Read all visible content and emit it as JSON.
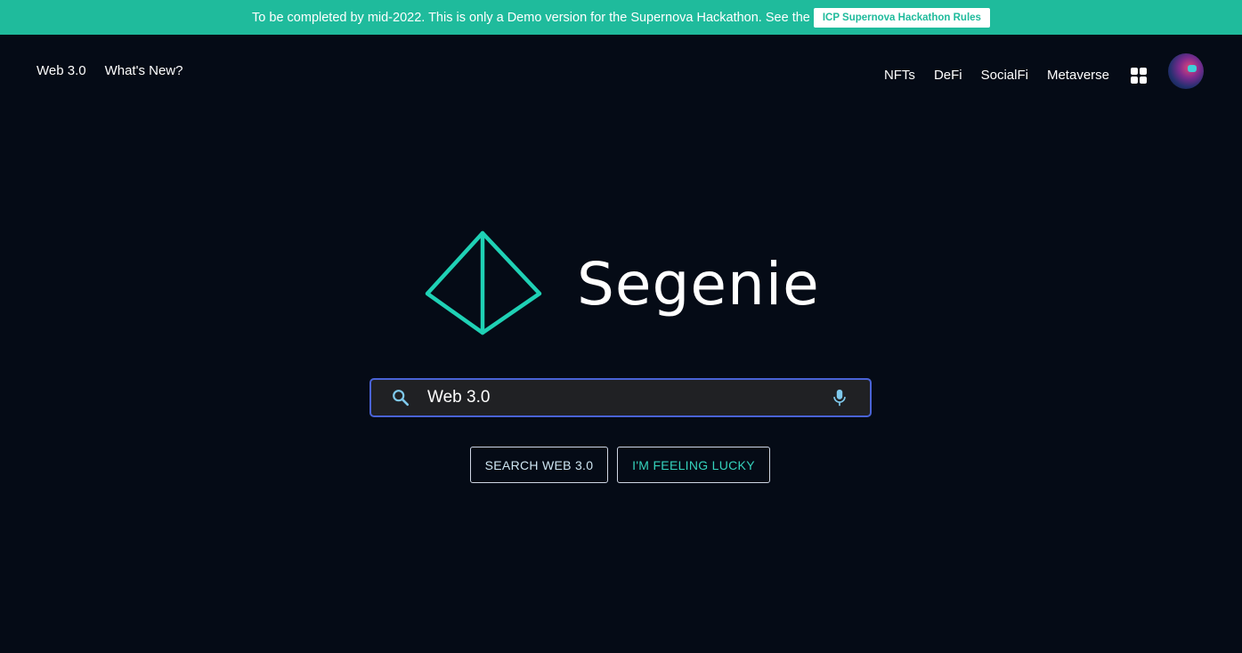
{
  "banner": {
    "text": "To be completed by mid-2022. This is only a Demo version for the Supernova Hackathon. See the",
    "button_label": "ICP Supernova Hackathon Rules"
  },
  "nav_left": [
    {
      "label": "Web 3.0"
    },
    {
      "label": "What's New?"
    }
  ],
  "nav_right": [
    {
      "label": "NFTs"
    },
    {
      "label": "DeFi"
    },
    {
      "label": "SocialFi"
    },
    {
      "label": "Metaverse"
    }
  ],
  "icons": {
    "apps": "apps-grid-icon",
    "avatar": "user-avatar",
    "search": "search-icon",
    "mic": "microphone-icon",
    "logo": "pyramid-logo-icon"
  },
  "logo": {
    "name": "Segenie"
  },
  "search": {
    "value": "Web 3.0"
  },
  "buttons": {
    "search_label": "SEARCH WEB 3.0",
    "lucky_label": "I'M FEELING LUCKY"
  },
  "colors": {
    "banner_bg": "#1fbb9c",
    "page_bg": "#050b16",
    "accent": "#1fd1b5",
    "search_border": "#4a63d6",
    "search_bg": "#202124"
  }
}
